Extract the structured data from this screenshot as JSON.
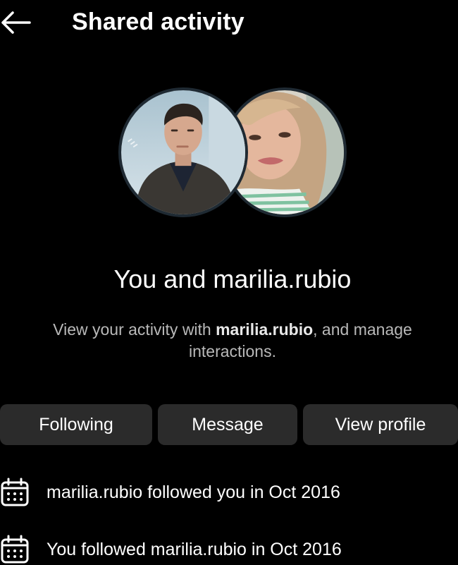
{
  "header": {
    "back_icon": "arrow-left-icon",
    "title": "Shared activity"
  },
  "avatars": {
    "left_alt": "Your profile photo",
    "right_alt": "marilia.rubio profile photo"
  },
  "headline": "You and marilia.rubio",
  "description": {
    "prefix": "View your activity with ",
    "username": "marilia.rubio",
    "suffix": ", and manage interactions."
  },
  "actions": {
    "following_label": "Following",
    "message_label": "Message",
    "view_profile_label": "View profile"
  },
  "activity": [
    {
      "icon": "calendar-icon",
      "text": "marilia.rubio followed you in Oct 2016"
    },
    {
      "icon": "calendar-icon",
      "text": "You followed marilia.rubio in Oct 2016"
    }
  ],
  "colors": {
    "background": "#000000",
    "button_bg": "#2b2b2b",
    "muted_text": "#b9b9b9",
    "avatar_ring": "#1f2a33"
  }
}
